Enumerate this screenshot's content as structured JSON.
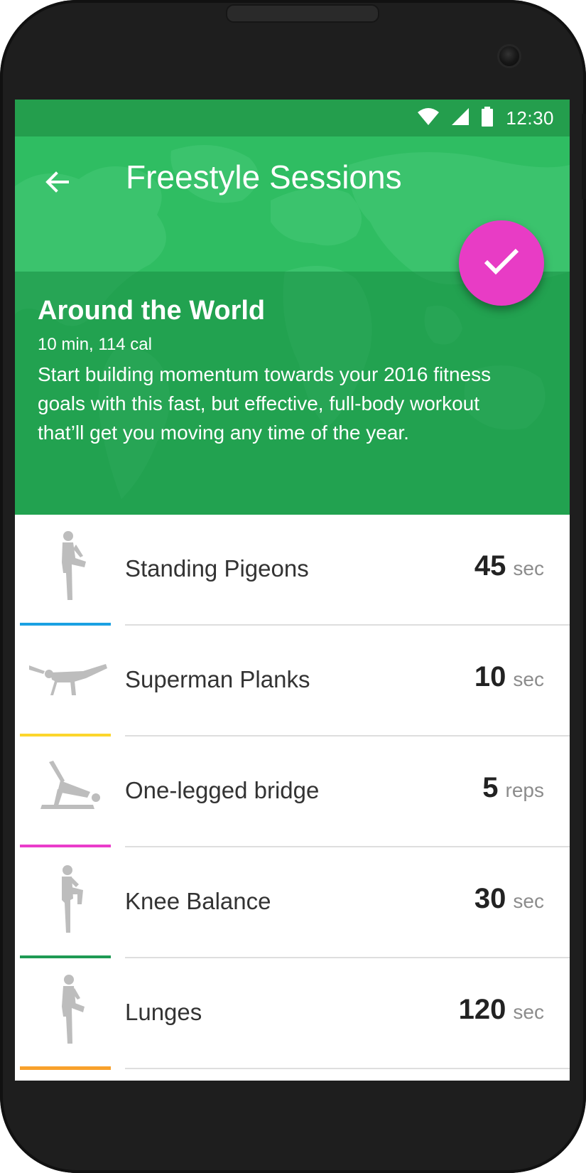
{
  "status_bar": {
    "time": "12:30",
    "icons": [
      "wifi-icon",
      "cell-signal-icon",
      "battery-icon"
    ]
  },
  "toolbar": {
    "back_icon": "arrow-left-icon",
    "title": "Freestyle Sessions"
  },
  "workout": {
    "title": "Around the World",
    "meta": "10 min, 114 cal",
    "description": "Start building momentum towards your 2016 fitness goals with this fast, but effective, full-body workout that’ll get you moving any time of the year."
  },
  "fab": {
    "icon": "checkmark-icon",
    "color": "#e83cc5"
  },
  "colors": {
    "header": "#2fbd62",
    "statusbar": "#249e4d"
  },
  "exercises": [
    {
      "name": "Standing Pigeons",
      "value": "45",
      "unit": "sec",
      "accent": "#1ba1e2",
      "icon": "standing-figure-icon"
    },
    {
      "name": "Superman Planks",
      "value": "10",
      "unit": "sec",
      "accent": "#fcd62c",
      "icon": "plank-figure-icon"
    },
    {
      "name": "One-legged bridge",
      "value": "5",
      "unit": "reps",
      "accent": "#ea3ccb",
      "icon": "bridge-figure-icon"
    },
    {
      "name": "Knee Balance",
      "value": "30",
      "unit": "sec",
      "accent": "#1e9a54",
      "icon": "knee-balance-figure-icon"
    },
    {
      "name": "Lunges",
      "value": "120",
      "unit": "sec",
      "accent": "#f8a12c",
      "icon": "lunge-figure-icon"
    }
  ]
}
